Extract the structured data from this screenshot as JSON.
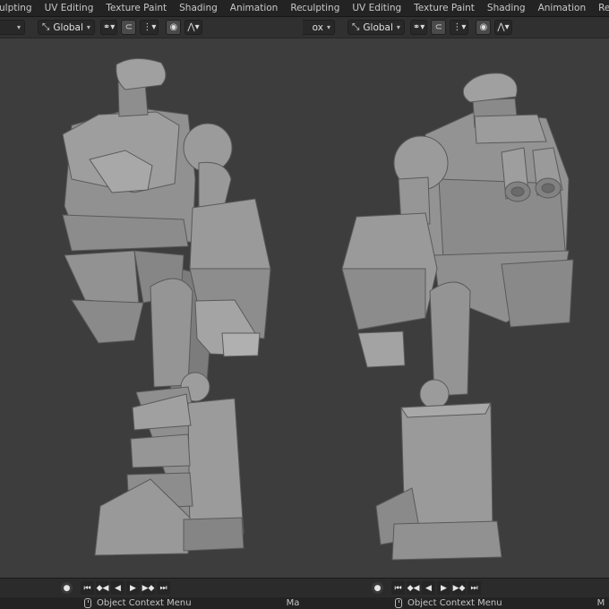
{
  "left": {
    "tabs": [
      "ulpting",
      "UV Editing",
      "Texture Paint",
      "Shading",
      "Animation",
      "Renderin"
    ],
    "header": {
      "mode_partial": "",
      "orientation": "Global"
    },
    "status": {
      "context_menu": "Object Context Menu",
      "trailing": "Ma"
    }
  },
  "right": {
    "tabs": [
      "culpting",
      "UV Editing",
      "Texture Paint",
      "Shading",
      "Animation",
      "Renderin"
    ],
    "header": {
      "mode_partial": "ox",
      "orientation": "Global"
    },
    "status": {
      "context_menu": "Object Context Menu",
      "trailing": "M"
    }
  },
  "playback": {
    "record": "●",
    "jump_start": "⏮",
    "prev_key": "◆◀",
    "play_reverse": "◀",
    "play": "▶",
    "next_key": "▶◆",
    "jump_end": "⏭"
  },
  "icons": [
    "transform-orientation-icon",
    "pivot-icon",
    "snap-icon",
    "snap-increment-icon",
    "proportional-edit-icon",
    "falloff-icon",
    "mouse-icon"
  ],
  "colors": {
    "viewport": "#3d3d3d",
    "model": "#8e8e8e",
    "header": "#303030",
    "tabbar": "#232323"
  }
}
